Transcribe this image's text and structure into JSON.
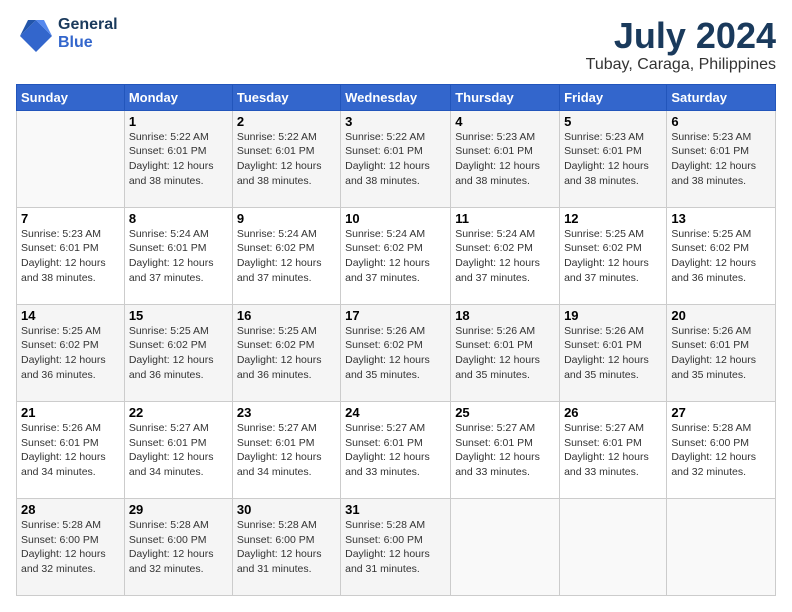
{
  "header": {
    "logo_line1": "General",
    "logo_line2": "Blue",
    "month": "July 2024",
    "location": "Tubay, Caraga, Philippines"
  },
  "days_of_week": [
    "Sunday",
    "Monday",
    "Tuesday",
    "Wednesday",
    "Thursday",
    "Friday",
    "Saturday"
  ],
  "weeks": [
    [
      {
        "day": "",
        "info": ""
      },
      {
        "day": "1",
        "info": "Sunrise: 5:22 AM\nSunset: 6:01 PM\nDaylight: 12 hours\nand 38 minutes."
      },
      {
        "day": "2",
        "info": "Sunrise: 5:22 AM\nSunset: 6:01 PM\nDaylight: 12 hours\nand 38 minutes."
      },
      {
        "day": "3",
        "info": "Sunrise: 5:22 AM\nSunset: 6:01 PM\nDaylight: 12 hours\nand 38 minutes."
      },
      {
        "day": "4",
        "info": "Sunrise: 5:23 AM\nSunset: 6:01 PM\nDaylight: 12 hours\nand 38 minutes."
      },
      {
        "day": "5",
        "info": "Sunrise: 5:23 AM\nSunset: 6:01 PM\nDaylight: 12 hours\nand 38 minutes."
      },
      {
        "day": "6",
        "info": "Sunrise: 5:23 AM\nSunset: 6:01 PM\nDaylight: 12 hours\nand 38 minutes."
      }
    ],
    [
      {
        "day": "7",
        "info": "Sunrise: 5:23 AM\nSunset: 6:01 PM\nDaylight: 12 hours\nand 38 minutes."
      },
      {
        "day": "8",
        "info": "Sunrise: 5:24 AM\nSunset: 6:01 PM\nDaylight: 12 hours\nand 37 minutes."
      },
      {
        "day": "9",
        "info": "Sunrise: 5:24 AM\nSunset: 6:02 PM\nDaylight: 12 hours\nand 37 minutes."
      },
      {
        "day": "10",
        "info": "Sunrise: 5:24 AM\nSunset: 6:02 PM\nDaylight: 12 hours\nand 37 minutes."
      },
      {
        "day": "11",
        "info": "Sunrise: 5:24 AM\nSunset: 6:02 PM\nDaylight: 12 hours\nand 37 minutes."
      },
      {
        "day": "12",
        "info": "Sunrise: 5:25 AM\nSunset: 6:02 PM\nDaylight: 12 hours\nand 37 minutes."
      },
      {
        "day": "13",
        "info": "Sunrise: 5:25 AM\nSunset: 6:02 PM\nDaylight: 12 hours\nand 36 minutes."
      }
    ],
    [
      {
        "day": "14",
        "info": "Sunrise: 5:25 AM\nSunset: 6:02 PM\nDaylight: 12 hours\nand 36 minutes."
      },
      {
        "day": "15",
        "info": "Sunrise: 5:25 AM\nSunset: 6:02 PM\nDaylight: 12 hours\nand 36 minutes."
      },
      {
        "day": "16",
        "info": "Sunrise: 5:25 AM\nSunset: 6:02 PM\nDaylight: 12 hours\nand 36 minutes."
      },
      {
        "day": "17",
        "info": "Sunrise: 5:26 AM\nSunset: 6:02 PM\nDaylight: 12 hours\nand 35 minutes."
      },
      {
        "day": "18",
        "info": "Sunrise: 5:26 AM\nSunset: 6:01 PM\nDaylight: 12 hours\nand 35 minutes."
      },
      {
        "day": "19",
        "info": "Sunrise: 5:26 AM\nSunset: 6:01 PM\nDaylight: 12 hours\nand 35 minutes."
      },
      {
        "day": "20",
        "info": "Sunrise: 5:26 AM\nSunset: 6:01 PM\nDaylight: 12 hours\nand 35 minutes."
      }
    ],
    [
      {
        "day": "21",
        "info": "Sunrise: 5:26 AM\nSunset: 6:01 PM\nDaylight: 12 hours\nand 34 minutes."
      },
      {
        "day": "22",
        "info": "Sunrise: 5:27 AM\nSunset: 6:01 PM\nDaylight: 12 hours\nand 34 minutes."
      },
      {
        "day": "23",
        "info": "Sunrise: 5:27 AM\nSunset: 6:01 PM\nDaylight: 12 hours\nand 34 minutes."
      },
      {
        "day": "24",
        "info": "Sunrise: 5:27 AM\nSunset: 6:01 PM\nDaylight: 12 hours\nand 33 minutes."
      },
      {
        "day": "25",
        "info": "Sunrise: 5:27 AM\nSunset: 6:01 PM\nDaylight: 12 hours\nand 33 minutes."
      },
      {
        "day": "26",
        "info": "Sunrise: 5:27 AM\nSunset: 6:01 PM\nDaylight: 12 hours\nand 33 minutes."
      },
      {
        "day": "27",
        "info": "Sunrise: 5:28 AM\nSunset: 6:00 PM\nDaylight: 12 hours\nand 32 minutes."
      }
    ],
    [
      {
        "day": "28",
        "info": "Sunrise: 5:28 AM\nSunset: 6:00 PM\nDaylight: 12 hours\nand 32 minutes."
      },
      {
        "day": "29",
        "info": "Sunrise: 5:28 AM\nSunset: 6:00 PM\nDaylight: 12 hours\nand 32 minutes."
      },
      {
        "day": "30",
        "info": "Sunrise: 5:28 AM\nSunset: 6:00 PM\nDaylight: 12 hours\nand 31 minutes."
      },
      {
        "day": "31",
        "info": "Sunrise: 5:28 AM\nSunset: 6:00 PM\nDaylight: 12 hours\nand 31 minutes."
      },
      {
        "day": "",
        "info": ""
      },
      {
        "day": "",
        "info": ""
      },
      {
        "day": "",
        "info": ""
      }
    ]
  ]
}
